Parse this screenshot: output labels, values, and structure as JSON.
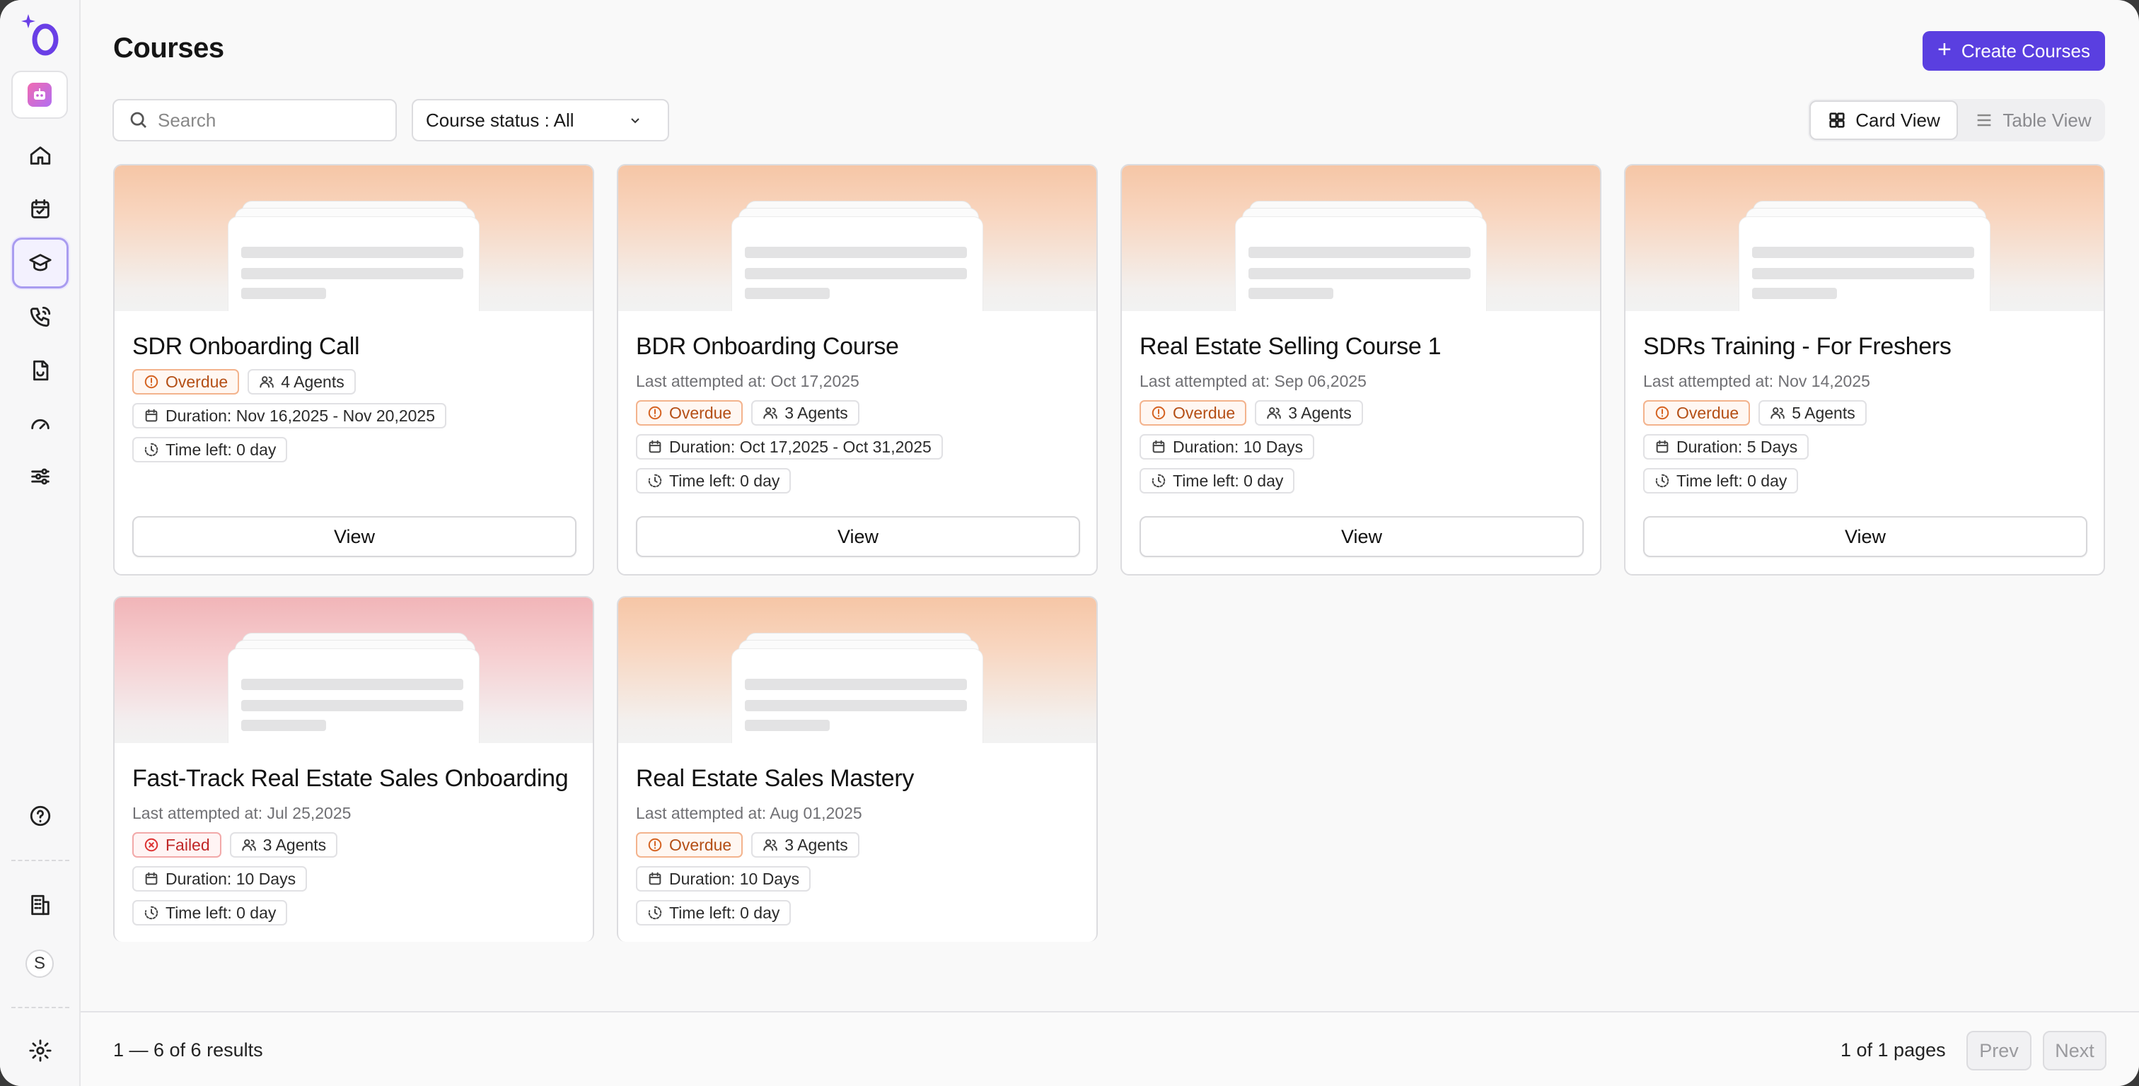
{
  "sidebar": {
    "items": [
      {
        "name": "home"
      },
      {
        "name": "calendar"
      },
      {
        "name": "courses",
        "active": true
      },
      {
        "name": "calls"
      },
      {
        "name": "reports"
      },
      {
        "name": "speedometer"
      },
      {
        "name": "settings-sliders"
      }
    ],
    "user_initial": "S"
  },
  "header": {
    "title": "Courses",
    "create_label": "Create Courses"
  },
  "filters": {
    "search_placeholder": "Search",
    "status_label": "Course status : All",
    "views": [
      "Card View",
      "Table View"
    ],
    "active_view": "Card View"
  },
  "courses": [
    {
      "title": "SDR Onboarding Call",
      "last_attempted": "",
      "status": "Overdue",
      "agents": "4 Agents",
      "duration": "Duration: Nov 16,2025 - Nov 20,2025",
      "time_left": "Time left: 0 day",
      "banner": "orange",
      "action": "View"
    },
    {
      "title": "BDR Onboarding Course",
      "last_attempted": "Last attempted at: Oct 17,2025",
      "status": "Overdue",
      "agents": "3 Agents",
      "duration": "Duration: Oct 17,2025 - Oct 31,2025",
      "time_left": "Time left: 0 day",
      "banner": "orange",
      "action": "View"
    },
    {
      "title": "Real Estate Selling Course 1",
      "last_attempted": "Last attempted at: Sep 06,2025",
      "status": "Overdue",
      "agents": "3 Agents",
      "duration": "Duration: 10 Days",
      "time_left": "Time left: 0 day",
      "banner": "orange",
      "action": "View"
    },
    {
      "title": "SDRs Training - For Freshers",
      "last_attempted": "Last attempted at: Nov 14,2025",
      "status": "Overdue",
      "agents": "5 Agents",
      "duration": "Duration: 5 Days",
      "time_left": "Time left: 0 day",
      "banner": "orange",
      "action": "View"
    },
    {
      "title": "Fast-Track Real Estate Sales Onboarding",
      "last_attempted": "Last attempted at: Jul 25,2025",
      "status": "Failed",
      "agents": "3 Agents",
      "duration": "Duration: 10 Days",
      "time_left": "Time left: 0 day",
      "banner": "pink",
      "action": ""
    },
    {
      "title": "Real Estate Sales Mastery",
      "last_attempted": "Last attempted at: Aug 01,2025",
      "status": "Overdue",
      "agents": "3 Agents",
      "duration": "Duration: 10 Days",
      "time_left": "Time left: 0 day",
      "banner": "orange",
      "action": ""
    }
  ],
  "footer": {
    "results": "1 — 6 of 6 results",
    "pages": "1 of 1 pages",
    "prev": "Prev",
    "next": "Next"
  },
  "colors": {
    "accent": "#5a3fe0",
    "overdue": "#d56322",
    "failed": "#d33333"
  }
}
